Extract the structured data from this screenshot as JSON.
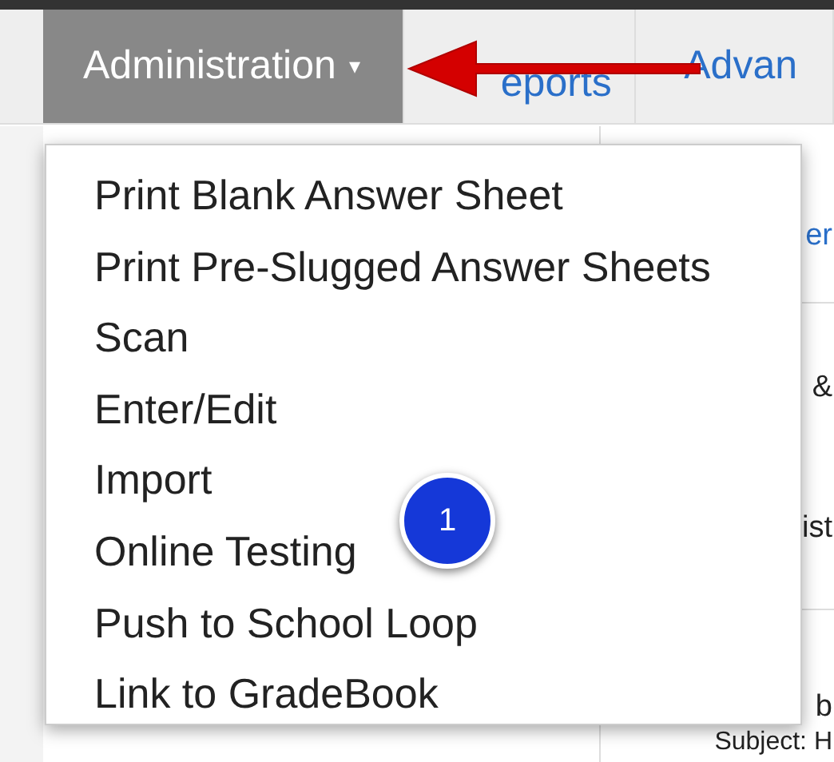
{
  "nav_tabs": [
    {
      "label": "Administration",
      "selected": true,
      "caret": "▾"
    },
    {
      "label": "eports",
      "selected": false
    },
    {
      "label": "Advan",
      "selected": false
    }
  ],
  "dropdown_items": [
    "Print Blank Answer Sheet",
    "Print Pre-Slugged Answer Sheets",
    "Scan",
    "Enter/Edit",
    "Import",
    "Online Testing",
    "Push to School Loop",
    "Link to GradeBook"
  ],
  "background_texts": [
    {
      "text": "er",
      "kind": "link"
    },
    {
      "text": "&",
      "kind": "plain"
    },
    {
      "text": "ist",
      "kind": "plain"
    },
    {
      "text": "b",
      "kind": "plain"
    }
  ],
  "footer_text": "Subject: H",
  "callout_badge": "1"
}
